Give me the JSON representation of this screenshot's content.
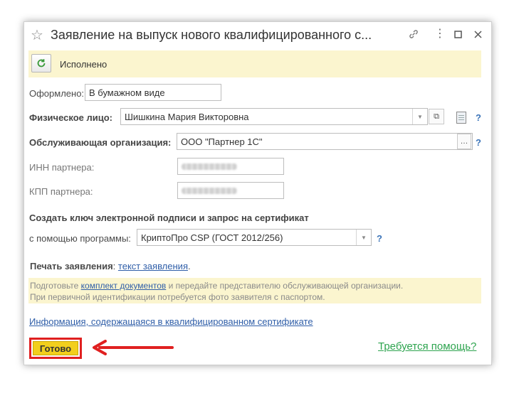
{
  "window": {
    "title": "Заявление на выпуск нового квалифицированного с...",
    "title_icons": [
      "star-icon",
      "link-icon",
      "more-icon",
      "maximize-icon",
      "close-icon"
    ]
  },
  "banner": {
    "status": "Исполнено"
  },
  "form": {
    "oformleno_label": "Оформлено:",
    "oformleno_value": "В бумажном виде",
    "person_label": "Физическое лицо:",
    "person_value": "Шишкина Мария Викторовна",
    "org_label": "Обслуживающая организация:",
    "org_value": "ООО \"Партнер 1С\"",
    "inn_label": "ИНН партнера:",
    "kpp_label": "КПП партнера:",
    "key_section": "Создать ключ электронной подписи и запрос на сертификат",
    "program_label": "с помощью программы:",
    "program_value": "КриптоПро CSP (ГОСТ 2012/256)",
    "print_label": "Печать заявления",
    "print_colon": ": ",
    "print_link": "текст заявления",
    "print_dot": ".",
    "help_mark": "?"
  },
  "note": {
    "line1_a": "Подготовьте ",
    "line1_link": "комплект документов",
    "line1_b": " и передайте представителю обслуживающей организации.",
    "line2": "При первичной идентификации потребуется фото заявителя с паспортом."
  },
  "info_link": "Информация, содержащаяся в квалифицированном сертификате",
  "footer": {
    "ready_button": "Готово",
    "help_link": "Требуется помощь?"
  },
  "colors": {
    "accent_yellow": "#f2cf1d",
    "banner_bg": "#fbf5cf",
    "highlight_red": "#e02020",
    "help_green": "#2ea44f",
    "link_blue": "#2f5ea8"
  }
}
